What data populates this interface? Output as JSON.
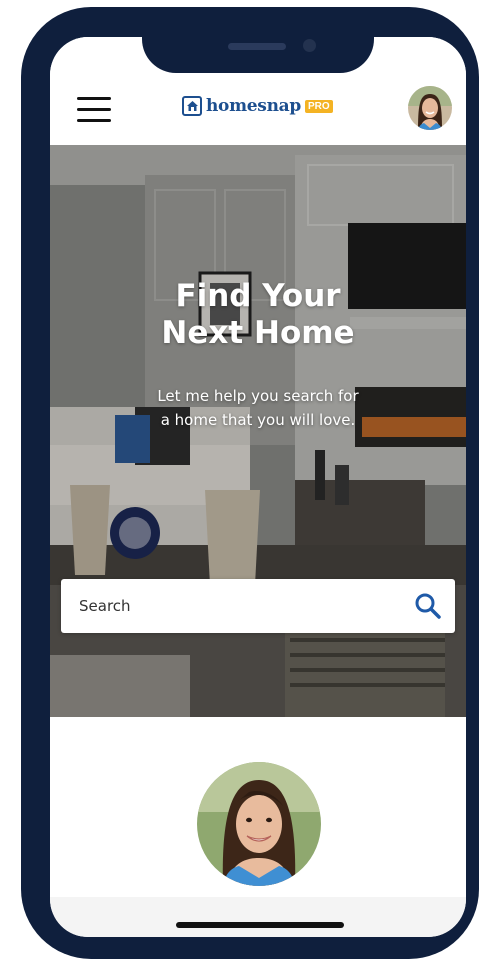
{
  "header": {
    "brand_name": "homesnap",
    "brand_badge": "PRO"
  },
  "hero": {
    "title_line1": "Find Your",
    "title_line2": "Next Home",
    "subtitle_line1": "Let me help you search for",
    "subtitle_line2": "a home that you will love."
  },
  "search": {
    "placeholder": "Search"
  },
  "icons": {
    "menu": "hamburger-menu-icon",
    "logo": "house-icon",
    "search": "magnifier-icon"
  },
  "colors": {
    "device_frame": "#0f1f3d",
    "brand_blue": "#1d4f8f",
    "pro_badge": "#f4b323",
    "search_icon": "#1f5aa8"
  }
}
